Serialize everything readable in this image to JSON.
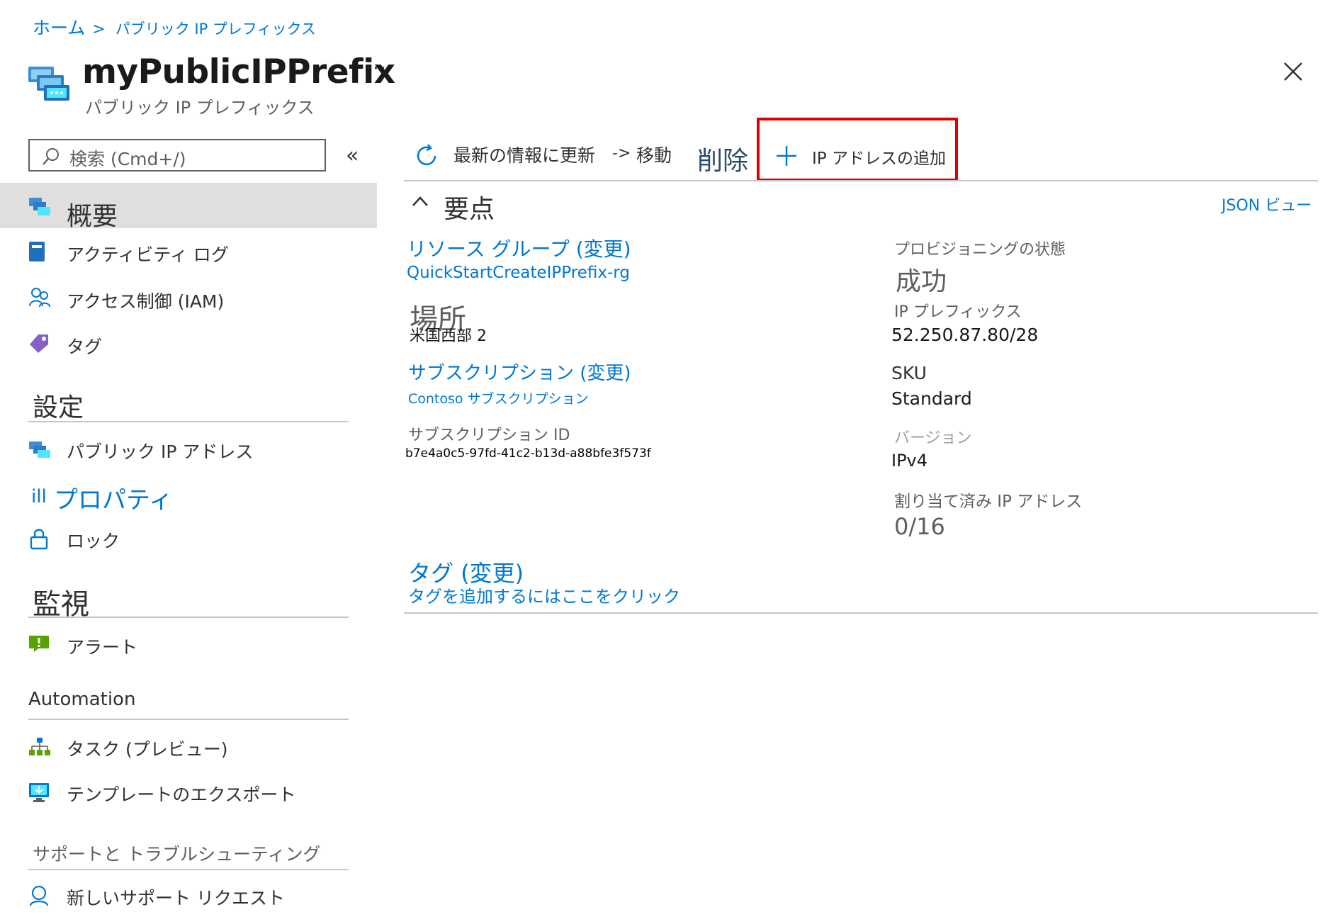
{
  "breadcrumb": {
    "home": "ホーム",
    "separator": ">",
    "current": "パブリック IP プレフィックス"
  },
  "header": {
    "title": "myPublicIPPrefix",
    "subtitle": "パブリック IP プレフィックス",
    "more": "···",
    "icons": {
      "resource": "public-ip-prefix-icon",
      "close": "close-icon"
    }
  },
  "search": {
    "placeholder": "検索 (Cmd+/)",
    "collapse": "«"
  },
  "nav": {
    "overview": "概要",
    "activity_log": "アクティビティ ログ",
    "iam": "アクセス制御 (IAM)",
    "tags": "タグ",
    "settings_header": "設定",
    "public_ip": "パブリック IP アドレス",
    "properties": "プロパティ",
    "properties_prefix": "ill",
    "lock": "ロック",
    "monitoring_header": "監視",
    "alerts": "アラート",
    "automation_header": "Automation",
    "tasks": "タスク (プレビュー)",
    "export_template": "テンプレートのエクスポート",
    "support_header": "サポートと トラブルシューティング",
    "new_support": "新しいサポート リクエスト"
  },
  "toolbar": {
    "refresh": "最新の情報に更新",
    "move_arrow": "->",
    "move": "移動",
    "delete": "削除",
    "add_ip": "IP アドレスの追加"
  },
  "essentials": {
    "header": "要点",
    "json_view": "JSON ビュー",
    "resource_group_label": "リソース グループ (変更)",
    "resource_group_value": "QuickStartCreateIPPrefix-rg",
    "location_label": "場所",
    "location_value": "米国西部 2",
    "subscription_label": "サブスクリプション (変更)",
    "subscription_value": "Contoso サブスクリプション",
    "subscription_id_label": "サブスクリプション ID",
    "subscription_id_value": "b7e4a0c5-97fd-41c2-b13d-a88bfe3f573f",
    "provisioning_label": "プロビジョニングの状態",
    "provisioning_value": "成功",
    "prefix_label": "IP プレフィックス",
    "prefix_value": "52.250.87.80/28",
    "sku_label": "SKU",
    "sku_value": "Standard",
    "version_label": "バージョン",
    "version_value": "IPv4",
    "allocated_label": "割り当て済み IP アドレス",
    "allocated_value": "0/16",
    "tags_label": "タグ (変更)",
    "tags_link": "タグを追加するにはここをクリック"
  },
  "colors": {
    "accent": "#0078d4",
    "highlight": "#e00000",
    "selected_bg": "#e1dfdd"
  }
}
